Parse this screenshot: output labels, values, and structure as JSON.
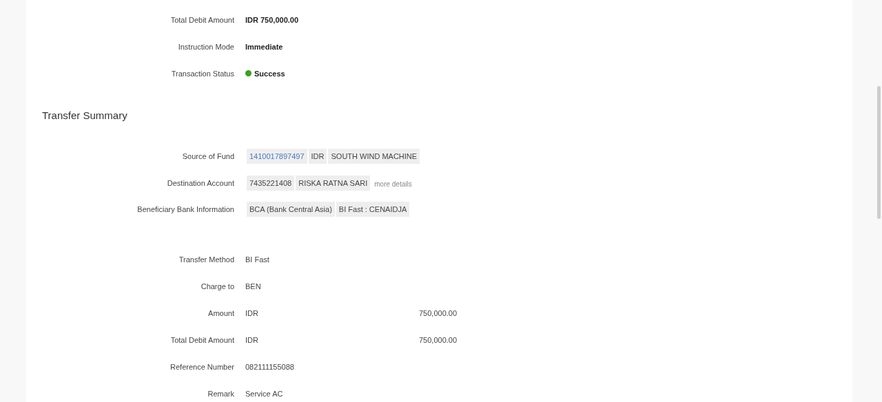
{
  "overview": [
    {
      "kind": "plain",
      "label": "Total Debit Amount",
      "value": "IDR 750,000.00"
    },
    {
      "kind": "plain",
      "label": "Instruction Mode",
      "value": "Immediate"
    },
    {
      "kind": "status",
      "label": "Transaction Status",
      "value": "Success",
      "color": "#3aa01e"
    }
  ],
  "transfer_summary": {
    "title": "Transfer Summary",
    "accounts": [
      {
        "kind": "chips",
        "label": "Source of Fund",
        "chips": [
          {
            "text": "1410017897497",
            "link": true
          },
          {
            "text": "IDR",
            "link": false
          },
          {
            "text": "SOUTH WIND MACHINE",
            "link": false
          }
        ]
      },
      {
        "kind": "chips",
        "label": "Destination Account",
        "chips": [
          {
            "text": "7435221408",
            "link": false
          },
          {
            "text": "RISKA RATNA SARI",
            "link": false
          }
        ],
        "more_link": "more details"
      },
      {
        "kind": "chips",
        "label": "Beneficiary Bank Information",
        "chips": [
          {
            "text": "BCA (Bank Central Asia)",
            "link": false
          },
          {
            "text": "BI Fast : CENAIDJA",
            "link": false
          }
        ]
      }
    ],
    "details": [
      {
        "kind": "plain",
        "label": "Transfer Method",
        "value": "BI Fast"
      },
      {
        "kind": "plain",
        "label": "Charge to",
        "value": "BEN"
      },
      {
        "kind": "amount",
        "label": "Amount",
        "currency": "IDR",
        "value": "750,000.00"
      },
      {
        "kind": "amount",
        "label": "Total Debit Amount",
        "currency": "IDR",
        "value": "750,000.00"
      },
      {
        "kind": "plain",
        "label": "Reference Number",
        "value": "082111155088"
      },
      {
        "kind": "plain",
        "label": "Remark",
        "value": "Service AC"
      }
    ]
  }
}
